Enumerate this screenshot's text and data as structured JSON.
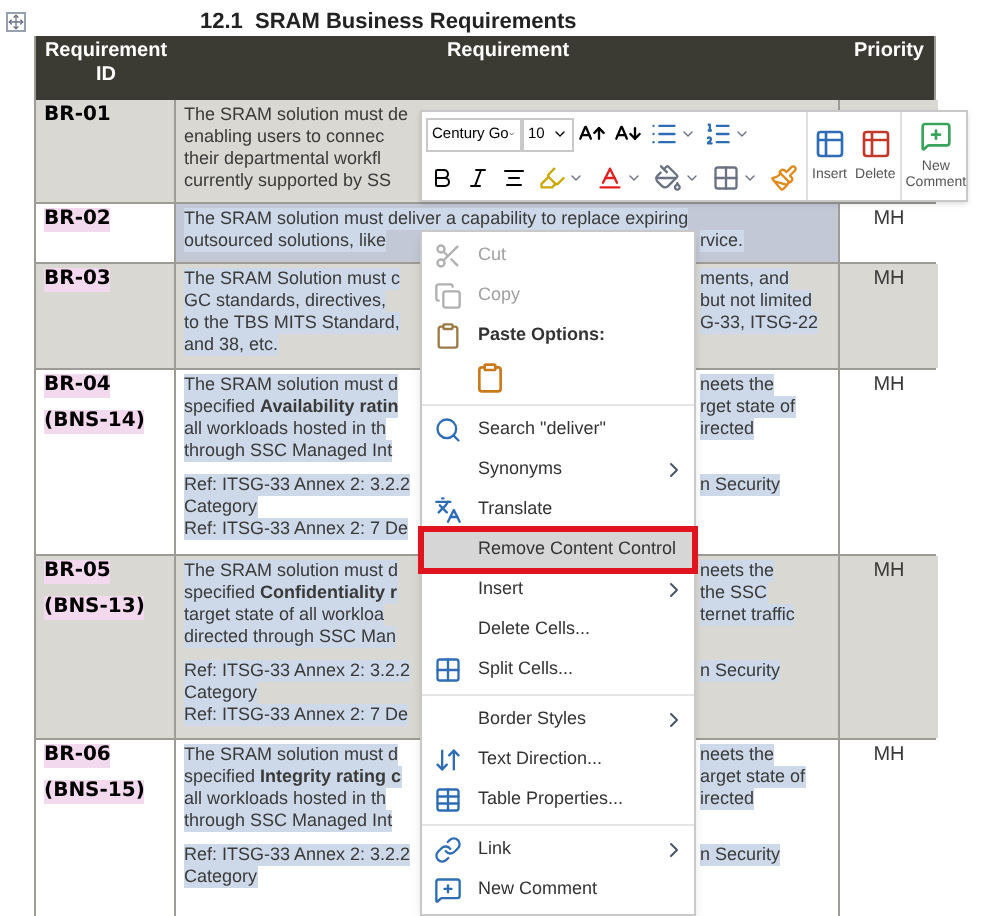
{
  "heading": "12.1  SRAM Business Requirements",
  "table": {
    "columns": [
      "Requirement ID",
      "Requirement",
      "Priority"
    ],
    "rows": [
      {
        "ids": [
          "BR-01"
        ],
        "content_control": false,
        "shaded": true,
        "cell_selected": false,
        "text_selected": false,
        "priority": "",
        "paragraphs": [
          [
            {
              "left": "The SRAM solution must de"
            },
            {
              "left": "enabling users to connec"
            },
            {
              "left": "their departmental workfl"
            },
            {
              "left": "currently supported by SS"
            }
          ]
        ]
      },
      {
        "ids": [
          "BR-02"
        ],
        "content_control": true,
        "shaded": false,
        "cell_selected": true,
        "text_selected": true,
        "priority": "MH",
        "paragraphs": [
          [
            {
              "left": "The SRAM solution must deliver a capability to replace expiring"
            },
            {
              "left": "outsourced solutions, like",
              "right": "rvice."
            }
          ]
        ]
      },
      {
        "ids": [
          "BR-03"
        ],
        "content_control": true,
        "shaded": true,
        "cell_selected": false,
        "text_selected": true,
        "priority": "MH",
        "paragraphs": [
          [
            {
              "left": "The SRAM Solution must c",
              "right": "ments, and"
            },
            {
              "left": "GC standards, directives,",
              "right": "but not limited"
            },
            {
              "left": "to the TBS MITS Standard,",
              "right": "G-33, ITSG-22"
            },
            {
              "left": "and 38, etc."
            }
          ]
        ]
      },
      {
        "ids": [
          "BR-04",
          "(BNS-14)"
        ],
        "content_control": true,
        "shaded": false,
        "cell_selected": false,
        "text_selected": true,
        "priority": "MH",
        "paragraphs": [
          [
            {
              "left": "The SRAM solution must d",
              "right": "neets the"
            },
            {
              "left": "specified **Availability ratin**",
              "right": "rget state of"
            },
            {
              "left": "all workloads hosted in th",
              "right": "irected"
            },
            {
              "left": "through SSC Managed Int"
            }
          ],
          [
            {
              "left": "Ref: ITSG-33 Annex 2: 3.2.2",
              "right": "n Security"
            },
            {
              "left": "Category"
            },
            {
              "left": "Ref: ITSG-33 Annex 2: 7 De"
            }
          ]
        ]
      },
      {
        "ids": [
          "BR-05",
          "(BNS-13)"
        ],
        "content_control": true,
        "shaded": true,
        "cell_selected": false,
        "text_selected": true,
        "priority": "MH",
        "paragraphs": [
          [
            {
              "left": "The SRAM solution must d",
              "right": "neets the"
            },
            {
              "left": "specified **Confidentiality r**",
              "right": "the SSC"
            },
            {
              "left": "target state of all workloa",
              "right": "ternet traffic"
            },
            {
              "left": "directed through SSC Man"
            }
          ],
          [
            {
              "left": "Ref: ITSG-33 Annex 2: 3.2.2",
              "right": "n Security"
            },
            {
              "left": "Category"
            },
            {
              "left": "Ref: ITSG-33 Annex 2: 7 De"
            }
          ]
        ]
      },
      {
        "ids": [
          "BR-06",
          "(BNS-15)"
        ],
        "content_control": true,
        "shaded": false,
        "cell_selected": false,
        "text_selected": true,
        "priority": "MH",
        "paragraphs": [
          [
            {
              "left": "The SRAM solution must d",
              "right": "neets the"
            },
            {
              "left": "specified **Integrity rating c**",
              "right": "arget state of"
            },
            {
              "left": "all workloads hosted in th",
              "right": "irected"
            },
            {
              "left": "through SSC Managed Int"
            }
          ],
          [
            {
              "left": "Ref: ITSG-33 Annex 2: 3.2.2",
              "right": "n Security"
            },
            {
              "left": "Category"
            }
          ]
        ]
      }
    ]
  },
  "mini_toolbar": {
    "font_name": "Century Go",
    "font_size": "10",
    "buttons": [
      "Insert",
      "Delete",
      "New Comment"
    ]
  },
  "context_menu": {
    "groups": [
      [
        {
          "kind": "item",
          "label": "Cut",
          "disabled": true,
          "highlighted": false,
          "submenu": false
        },
        {
          "kind": "item",
          "label": "Copy",
          "disabled": true,
          "highlighted": false,
          "submenu": false
        },
        {
          "kind": "heading",
          "label": "Paste Options:",
          "disabled": false,
          "highlighted": false,
          "submenu": false
        },
        {
          "kind": "paste",
          "disabled": false,
          "highlighted": false,
          "submenu": false
        }
      ],
      [
        {
          "kind": "item",
          "label": "Search \"deliver\"",
          "disabled": false,
          "highlighted": false,
          "submenu": false
        },
        {
          "kind": "item",
          "label": "Synonyms",
          "disabled": false,
          "highlighted": false,
          "submenu": true
        },
        {
          "kind": "item",
          "label": "Translate",
          "disabled": false,
          "highlighted": false,
          "submenu": false
        },
        {
          "kind": "item",
          "label": "Remove Content Control",
          "disabled": false,
          "highlighted": true,
          "submenu": false
        },
        {
          "kind": "item",
          "label": "Insert",
          "disabled": false,
          "highlighted": false,
          "submenu": true
        },
        {
          "kind": "item",
          "label": "Delete Cells...",
          "disabled": false,
          "highlighted": false,
          "submenu": false
        },
        {
          "kind": "item",
          "label": "Split Cells...",
          "disabled": false,
          "highlighted": false,
          "submenu": false
        }
      ],
      [
        {
          "kind": "item",
          "label": "Border Styles",
          "disabled": false,
          "highlighted": false,
          "submenu": true
        },
        {
          "kind": "item",
          "label": "Text Direction...",
          "disabled": false,
          "highlighted": false,
          "submenu": false
        },
        {
          "kind": "item",
          "label": "Table Properties...",
          "disabled": false,
          "highlighted": false,
          "submenu": false
        }
      ],
      [
        {
          "kind": "item",
          "label": "Link",
          "disabled": false,
          "highlighted": false,
          "submenu": true
        },
        {
          "kind": "item",
          "label": "New Comment",
          "disabled": false,
          "highlighted": false,
          "submenu": false
        }
      ]
    ]
  }
}
